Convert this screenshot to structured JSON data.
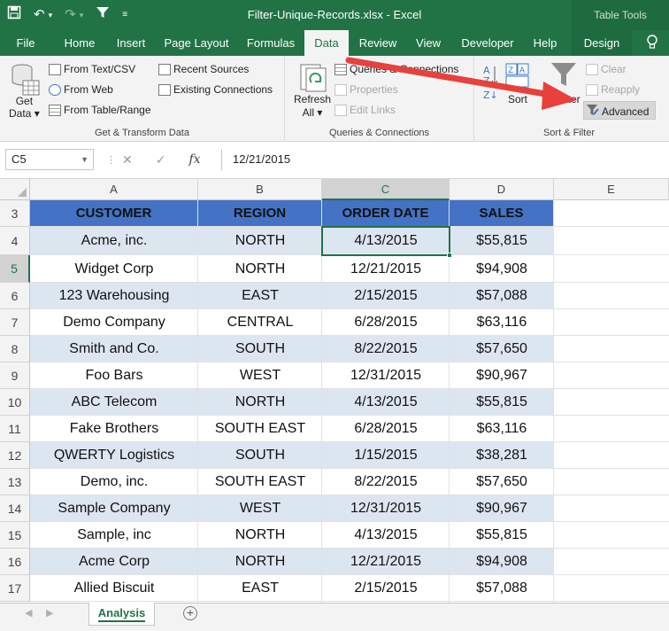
{
  "window": {
    "title": "Filter-Unique-Records.xlsx  -  Excel",
    "context_tab_group": "Table Tools"
  },
  "tabs": [
    {
      "label": "File"
    },
    {
      "label": "Home"
    },
    {
      "label": "Insert"
    },
    {
      "label": "Page Layout"
    },
    {
      "label": "Formulas"
    },
    {
      "label": "Data"
    },
    {
      "label": "Review"
    },
    {
      "label": "View"
    },
    {
      "label": "Developer"
    },
    {
      "label": "Help"
    },
    {
      "label": "Design"
    }
  ],
  "ribbon": {
    "get_transform": {
      "label": "Get & Transform Data",
      "get_data_line1": "Get",
      "get_data_line2": "Data",
      "from_text_csv": "From Text/CSV",
      "from_web": "From Web",
      "from_table_range": "From Table/Range",
      "recent_sources": "Recent Sources",
      "existing_connections": "Existing Connections"
    },
    "queries": {
      "label": "Queries & Connections",
      "refresh_line1": "Refresh",
      "refresh_line2": "All",
      "queries_connections": "Queries & Connections",
      "properties": "Properties",
      "edit_links": "Edit Links"
    },
    "sort_filter": {
      "label": "Sort & Filter",
      "sort": "Sort",
      "filter": "Filter",
      "clear": "Clear",
      "reapply": "Reapply",
      "advanced": "Advanced"
    }
  },
  "formula_bar": {
    "name_box": "C5",
    "fx": "fx",
    "value": "12/21/2015"
  },
  "columns": [
    "A",
    "B",
    "C",
    "D",
    "E"
  ],
  "table": {
    "headers": [
      "CUSTOMER",
      "REGION",
      "ORDER DATE",
      "SALES"
    ],
    "rows": [
      {
        "row": "3"
      },
      {
        "row": "4",
        "cells": [
          "Acme, inc.",
          "NORTH",
          "4/13/2015",
          "$55,815"
        ]
      },
      {
        "row": "5",
        "cells": [
          "Widget Corp",
          "NORTH",
          "12/21/2015",
          "$94,908"
        ]
      },
      {
        "row": "6",
        "cells": [
          "123 Warehousing",
          "EAST",
          "2/15/2015",
          "$57,088"
        ]
      },
      {
        "row": "7",
        "cells": [
          "Demo Company",
          "CENTRAL",
          "6/28/2015",
          "$63,116"
        ]
      },
      {
        "row": "8",
        "cells": [
          "Smith and Co.",
          "SOUTH",
          "8/22/2015",
          "$57,650"
        ]
      },
      {
        "row": "9",
        "cells": [
          "Foo Bars",
          "WEST",
          "12/31/2015",
          "$90,967"
        ]
      },
      {
        "row": "10",
        "cells": [
          "ABC Telecom",
          "NORTH",
          "4/13/2015",
          "$55,815"
        ]
      },
      {
        "row": "11",
        "cells": [
          "Fake Brothers",
          "SOUTH EAST",
          "6/28/2015",
          "$63,116"
        ]
      },
      {
        "row": "12",
        "cells": [
          "QWERTY Logistics",
          "SOUTH",
          "1/15/2015",
          "$38,281"
        ]
      },
      {
        "row": "13",
        "cells": [
          "Demo, inc.",
          "SOUTH EAST",
          "8/22/2015",
          "$57,650"
        ]
      },
      {
        "row": "14",
        "cells": [
          "Sample Company",
          "WEST",
          "12/31/2015",
          "$90,967"
        ]
      },
      {
        "row": "15",
        "cells": [
          "Sample, inc",
          "NORTH",
          "4/13/2015",
          "$55,815"
        ]
      },
      {
        "row": "16",
        "cells": [
          "Acme Corp",
          "NORTH",
          "12/21/2015",
          "$94,908"
        ]
      },
      {
        "row": "17",
        "cells": [
          "Allied Biscuit",
          "EAST",
          "2/15/2015",
          "$57,088"
        ]
      }
    ]
  },
  "sheet_tabs": [
    {
      "label": "Analysis"
    }
  ],
  "colors": {
    "excel_green": "#217346",
    "table_header": "#4472c4",
    "table_band": "#dce6f1",
    "annotation_arrow": "#e8403a"
  }
}
